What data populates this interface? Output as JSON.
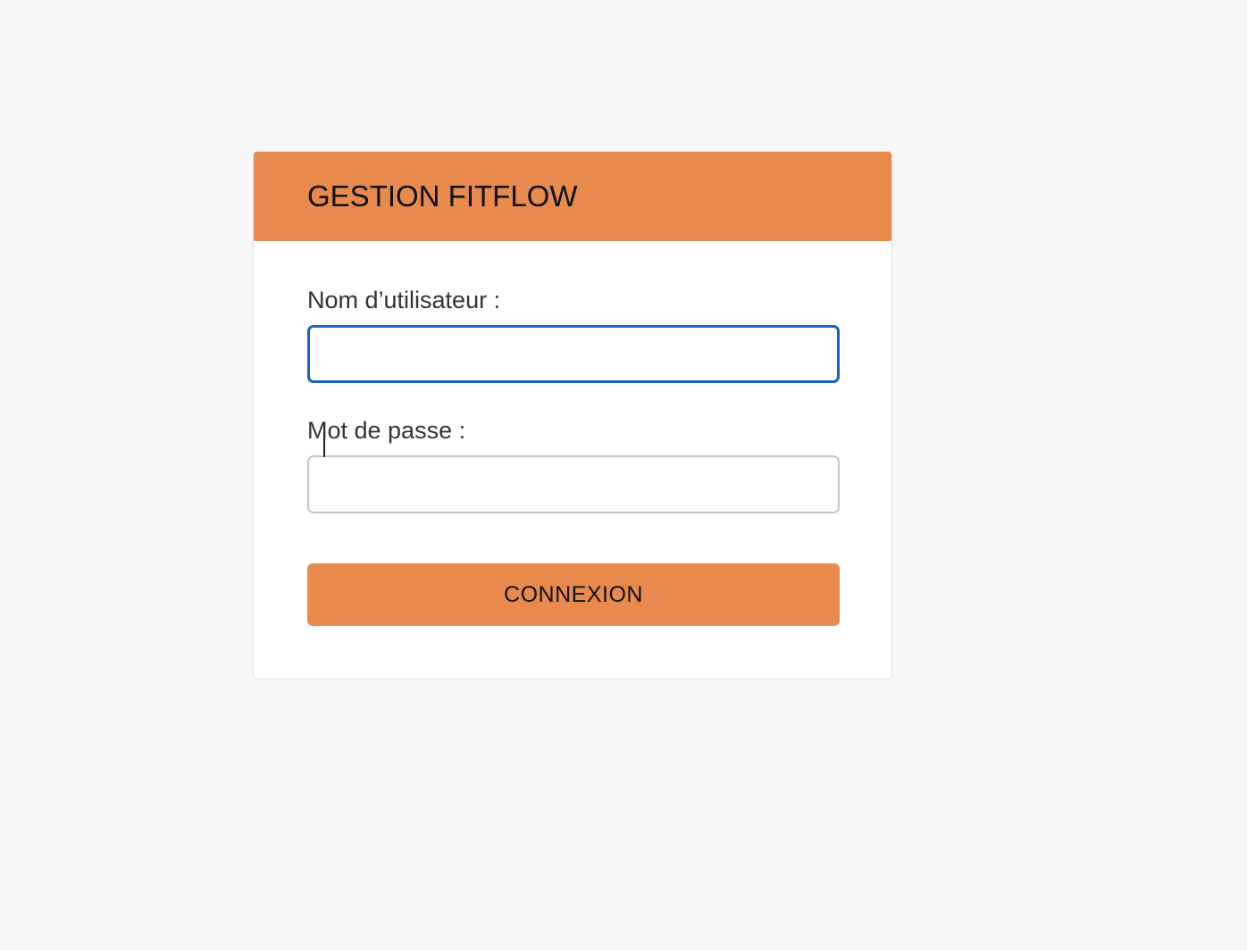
{
  "header": {
    "title": "GESTION FITFLOW"
  },
  "form": {
    "username_label": "Nom d’utilisateur :",
    "username_value": "",
    "password_label": "Mot de passe :",
    "password_value": "",
    "submit_label": "CONNEXION"
  },
  "colors": {
    "accent": "#e8894d",
    "focus": "#1464c0",
    "background": "#f7f7f7"
  }
}
